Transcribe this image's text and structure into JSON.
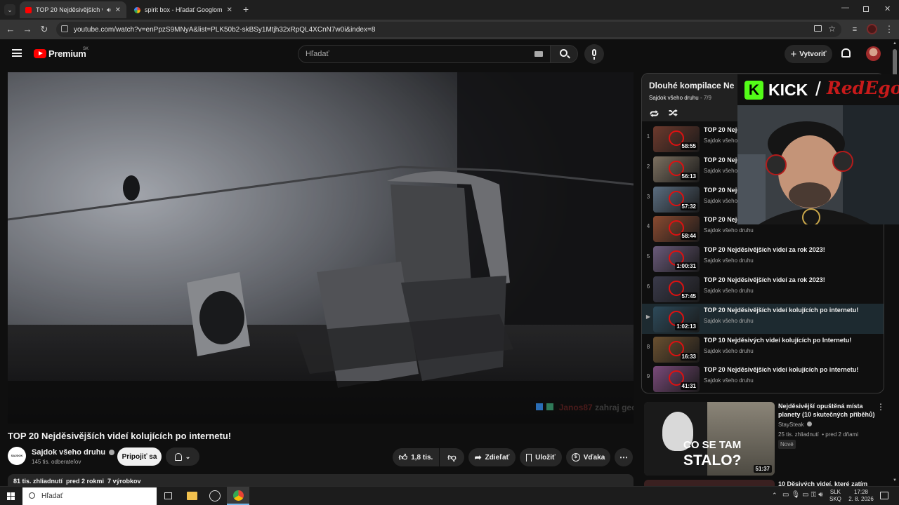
{
  "browser": {
    "tabs": [
      {
        "title": "TOP 20 Nejděsivějších vide",
        "active": true
      },
      {
        "title": "spirit box - Hľadať Googlom",
        "active": false
      }
    ],
    "url": "youtube.com/watch?v=enPpzS9MNyA&list=PLK50b2-skBSy1Mtjh32xRpQL4XCnN7w0i&index=8"
  },
  "youtube": {
    "brand": "Premium",
    "region": "SK",
    "search_placeholder": "Hľadať",
    "create_label": "Vytvoriť"
  },
  "video": {
    "title": "TOP 20 Nejděsivějších videí kolujících po internetu!",
    "chat_overlay_user": "Janos87",
    "chat_overlay_text": "zahraj geodes a budes na"
  },
  "channel": {
    "name": "Sajdok všeho druhu",
    "subscribers": "145 tis. odberateľov",
    "avatar_text": "SAJDOK",
    "join_label": "Pripojiť sa"
  },
  "actions": {
    "likes": "1,8 tis.",
    "share": "Zdieľať",
    "save": "Uložiť",
    "thanks": "Vďaka"
  },
  "description": {
    "summary": "81 tis. zhliadnutí  pred 2 rokmi  7 výrobkov"
  },
  "playlist": {
    "title": "Dlouhé kompilace Ne",
    "channel": "Sajdok všeho druhu",
    "position": "- 7/9",
    "items": [
      {
        "idx": "1",
        "title": "TOP 20 Nejd",
        "channel": "Sajdok všeho",
        "duration": "58:55"
      },
      {
        "idx": "2",
        "title": "TOP 20 Nejd",
        "channel": "Sajdok všeho",
        "duration": "56:13"
      },
      {
        "idx": "3",
        "title": "TOP 20 Nejd",
        "channel": "Sajdok všeho",
        "duration": "57:32"
      },
      {
        "idx": "4",
        "title": "TOP 20 Nejd",
        "channel": "Sajdok všeho druhu",
        "duration": "58:44"
      },
      {
        "idx": "5",
        "title": "TOP 20 Nejděsivějších videí za rok 2023!",
        "channel": "Sajdok všeho druhu",
        "duration": "1:00:31"
      },
      {
        "idx": "6",
        "title": "TOP 20 Nejděsivějších videí za rok 2023!",
        "channel": "Sajdok všeho druhu",
        "duration": "57:45"
      },
      {
        "idx": "▶",
        "title": "TOP 20 Nejděsivějších videí kolujících po internetu!",
        "channel": "Sajdok všeho druhu",
        "duration": "1:02:13"
      },
      {
        "idx": "8",
        "title": "TOP 10 Nejděsivých videí kolujících po Internetu!",
        "channel": "Sajdok všeho druhu",
        "duration": "16:33"
      },
      {
        "idx": "9",
        "title": "TOP 20 Nejděsivějších videí kolujících po internetu!",
        "channel": "Sajdok všeho druhu",
        "duration": "41:31"
      }
    ]
  },
  "recommended": [
    {
      "title": "Nejděsivější opuštěná místa planety (10 skutečných příběhů)",
      "channel": "StaySteak",
      "meta": "25 tis. zhliadnutí  • pred 2 dňami",
      "badge": "Nové",
      "duration": "51:37",
      "thumb_text_1": "CO SE TAM",
      "thumb_text_2": "STALO?"
    },
    {
      "title": "10 Děsivých videí, které zatím"
    }
  ],
  "webcam": {
    "logo_left": "KICK",
    "logo_sep": "/",
    "logo_right": "RedEgo"
  },
  "taskbar": {
    "search_placeholder": "Hľadať",
    "lang_1": "SLK",
    "lang_2": "SKQ",
    "time": "17:28",
    "date": "2. 8. 2026"
  },
  "colors": {
    "yt_red": "#ff0000",
    "bg": "#0f0f0f",
    "kick_green": "#53fc18"
  }
}
